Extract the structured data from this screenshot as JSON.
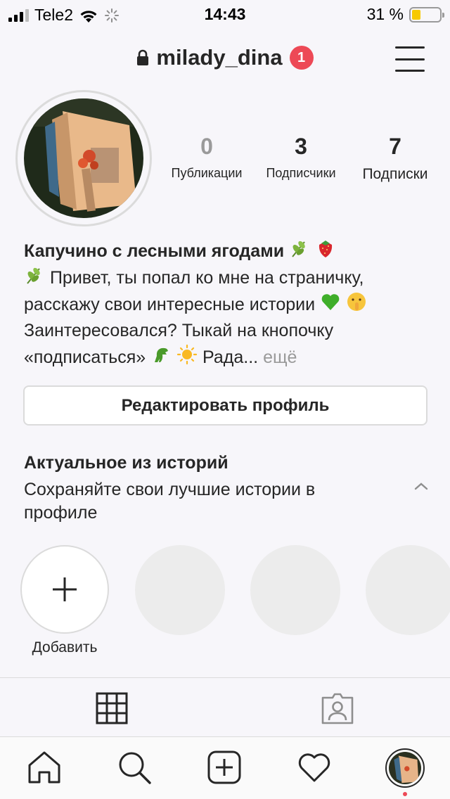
{
  "status_bar": {
    "carrier": "Tele2",
    "time": "14:43",
    "battery_percent": "31 %",
    "battery_level": 0.31,
    "battery_color": "#f7c900"
  },
  "header": {
    "username": "milady_dina",
    "notification_count": "1",
    "lock_icon": "lock-icon",
    "menu_icon": "hamburger-menu-icon",
    "badge_color": "#ed4956"
  },
  "profile": {
    "stats": [
      {
        "value": "0",
        "label": "Публикации"
      },
      {
        "value": "3",
        "label": "Подписчики"
      },
      {
        "value": "7",
        "label": "Подписки"
      }
    ],
    "bio": {
      "name": "Капучино с лесными ягодами",
      "line1": "Привет, ты попал ко мне на страничку,",
      "line2": "расскажу свои интересные истории",
      "line3": "Заинтересовался? Тыкай на кнопочку",
      "line4": "«подписаться»",
      "line4_end": "Рада...",
      "more": "ещё"
    },
    "edit_button": "Редактировать профиль"
  },
  "highlights": {
    "title": "Актуальное из историй",
    "subtitle": "Сохраняйте свои лучшие истории в профиле",
    "add_label": "Добавить"
  },
  "tabs": {
    "grid_icon": "grid-icon",
    "tagged_icon": "tagged-person-icon"
  },
  "bottom_nav": {
    "icons": [
      "home-icon",
      "search-icon",
      "new-post-icon",
      "activity-heart-icon",
      "profile-avatar"
    ]
  }
}
